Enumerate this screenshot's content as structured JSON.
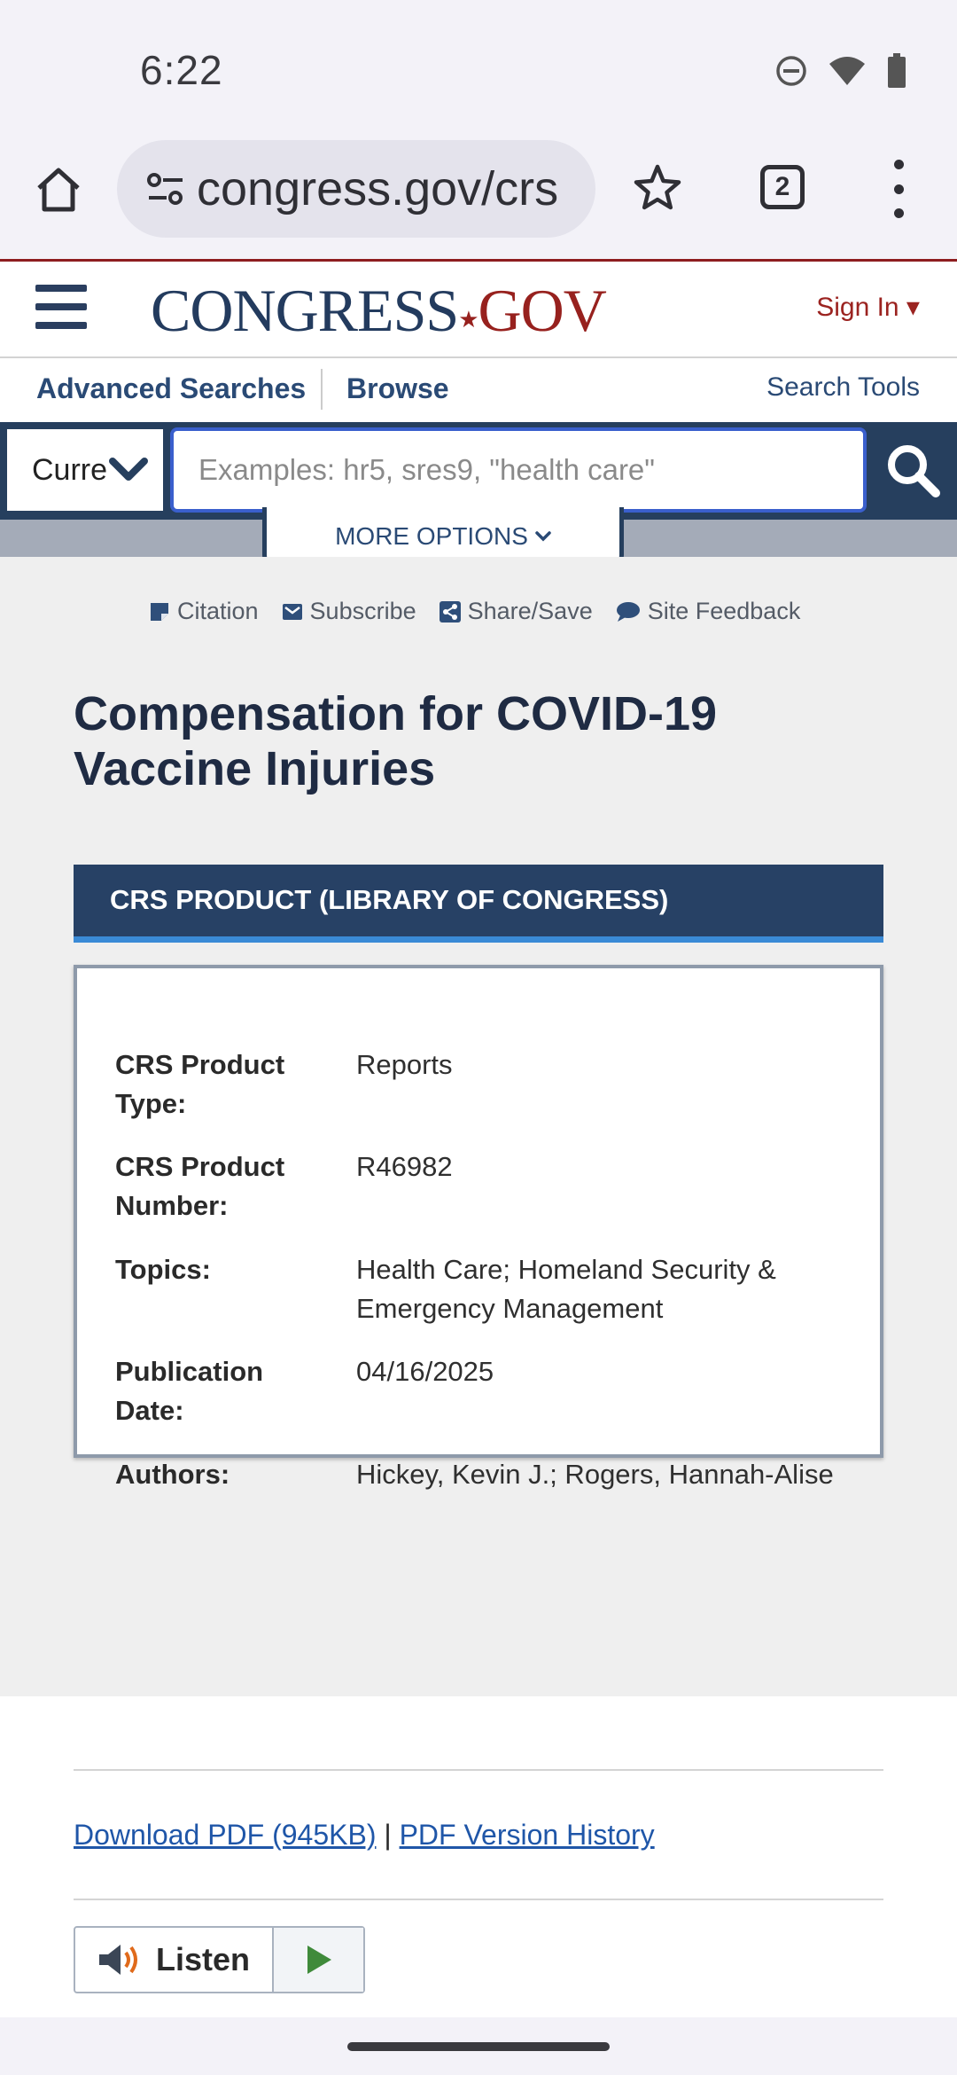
{
  "status_bar": {
    "time": "6:22",
    "icons": [
      "do-not-disturb-icon",
      "wifi-icon",
      "battery-icon"
    ]
  },
  "browser": {
    "url": "congress.gov/crs",
    "tab_count": "2",
    "icons": [
      "home-icon",
      "site-settings-icon",
      "star-icon",
      "tabs-icon",
      "more-vert-icon"
    ]
  },
  "header": {
    "logo_main": "CONGRESS",
    "logo_star": "★",
    "logo_suffix": "GOV",
    "sign_in": "Sign In ▾"
  },
  "nav": {
    "advanced_searches": "Advanced Searches",
    "browse": "Browse",
    "search_tools": "Search Tools"
  },
  "search": {
    "collection_value": "Curre",
    "placeholder": "Examples: hr5, sres9, \"health care\"",
    "more_options": "MORE OPTIONS"
  },
  "tools": {
    "citation": "Citation",
    "subscribe": "Subscribe",
    "share_save": "Share/Save",
    "site_feedback": "Site Feedback"
  },
  "page": {
    "title": "Compensation for COVID-19 Vaccine Injuries",
    "banner": "CRS PRODUCT (LIBRARY OF CONGRESS)"
  },
  "details": [
    {
      "label": "CRS Product Type:",
      "value": "Reports"
    },
    {
      "label": "CRS Product Number:",
      "value": "R46982"
    },
    {
      "label": "Topics:",
      "value": "Health Care; Homeland Security & Emergency Management"
    },
    {
      "label": "Publication Date:",
      "value": "04/16/2025"
    },
    {
      "label": "Authors:",
      "value": "Hickey, Kevin J.; Rogers, Hannah-Alise"
    }
  ],
  "downloads": {
    "pdf_link": "Download PDF (945KB)",
    "separator": "|",
    "history_link": "PDF Version History"
  },
  "listen": {
    "label": "Listen"
  },
  "colors": {
    "brand_navy": "#263f5e",
    "brand_red": "#97211e",
    "link_blue": "#1f56a8",
    "accent_blue": "#3a8ad6"
  }
}
